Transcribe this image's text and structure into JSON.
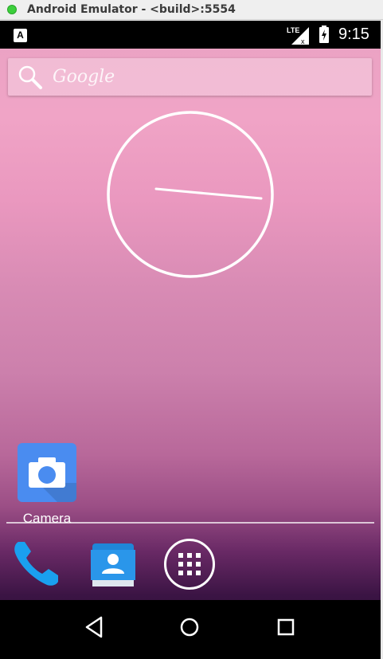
{
  "window": {
    "title": "Android Emulator - <build>:5554"
  },
  "statusbar": {
    "network": "LTE",
    "time": "9:15",
    "notification_icon": "A"
  },
  "search": {
    "label": "Google"
  },
  "apps": {
    "camera_label": "Camera"
  },
  "colors": {
    "app_blue": "#4a8cf0",
    "phone_blue": "#1aa0ef",
    "contacts_blue": "#1f86d8"
  }
}
